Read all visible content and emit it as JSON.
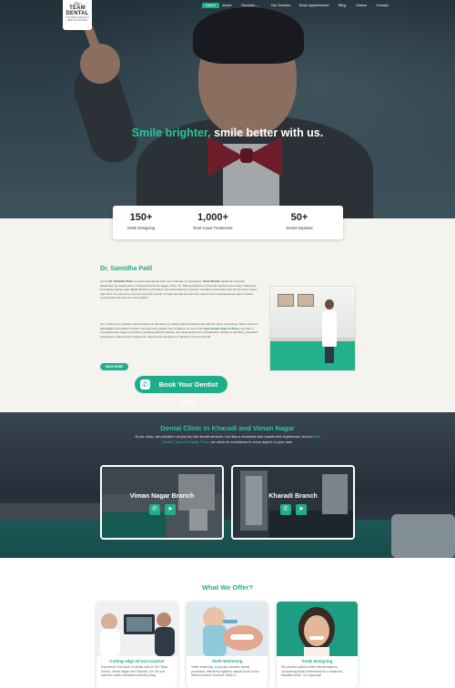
{
  "brand": {
    "logo_top": "The",
    "logo_name": "TEAM DENTAL",
    "logo_tagline": "THE SMILE DESIGN & IMPLANT CENTRE"
  },
  "nav": {
    "items": [
      {
        "label": "Home",
        "active": true
      },
      {
        "label": "About"
      },
      {
        "label": "Services ⌄"
      },
      {
        "label": "Our Doctors"
      },
      {
        "label": "Book Appointment"
      },
      {
        "label": "Blog"
      },
      {
        "label": "Videos"
      },
      {
        "label": "Contact"
      }
    ]
  },
  "hero": {
    "title_accent": "Smile brighter,",
    "title_rest": " smile better with us."
  },
  "stats": [
    {
      "number": "150+",
      "label": "Smile Designing"
    },
    {
      "number": "1,000+",
      "label": "Root Canal Treatments"
    },
    {
      "number": "50+",
      "label": "Dental Implants"
    }
  ],
  "about": {
    "doctor_name": "Dr. Samidha Patil",
    "para1_pre": "Led by ",
    "para1_name": "Dr. Samidha Patil",
    "para1_mid": ", an esteemed dentist with over a decade of experience, ",
    "para1_brand": "Team Dental",
    "para1_post": " stands as a premier destination for dental care in Kharadi and Viman Nagar, Pune. Dr. Patil specializes in cosmetic dentistry and smile makeovers, leveraging cutting-edge digital dentistry techniques. Recently trained in injection moulding composites and the No-Prep veneer approach, her expertise ensures top-notch results. At Team Dental we blend art, science and compassionate care to deliver exceptional outcomes for every patient.",
    "para2_pre": "Our mission is to redefine dental treatment standards by uniting skilled professionals with the latest technology. With a focus on affordability and patient comfort, we help every patient feel confident. As one of the ",
    "para2_brand": "best dental clinics in Pune",
    "para2_post": ", we offer a comprehensive range of services, including dental implants, root canal treatments, orthodontics, children's dentistry, preventive procedures, and cosmetic treatments. Experience excellence in dentistry at Team Dental.",
    "read_more": "READ MORE",
    "call_label": "Book Your Dentist Call"
  },
  "branches": {
    "title": "Dental Clinic in Kharadi and Viman Nagar",
    "text_pre": "At our clinic, we prioritize not just top-tier dental services, but also a seamless and hassle-free experience. As the ",
    "text_link": "Best Dental Clinic in Kharadi, Pune",
    "text_post": ", we strive for excellence in every aspect of your care.",
    "cards": [
      {
        "name": "Viman Nagar Branch"
      },
      {
        "name": "Kharadi Branch"
      }
    ],
    "icons": {
      "phone": "phone-icon",
      "direction": "navigate-icon"
    }
  },
  "offers": {
    "title": "What We Offer?",
    "items": [
      {
        "title": "Cutting-edge 3d oral scanner",
        "desc": "Experience the future of dental care at The Team Dental, Viman Nagar and Kharadi. Our 3D oral scanner makes treatment planning easy"
      },
      {
        "title": "Teeth Whitening",
        "desc": "Teeth whitening, a popular cosmetic dental procedure, effectively lightens natural tooth colour without surface removal. While a"
      },
      {
        "title": "Smile designing",
        "desc": "We provide holistic smile transformations, considering facial dimensions for a balanced, beautiful smile. Our approach"
      }
    ]
  },
  "colors": {
    "accent": "#1fae8c",
    "accent_bright": "#28c79c",
    "beige": "#f4f3ee"
  }
}
